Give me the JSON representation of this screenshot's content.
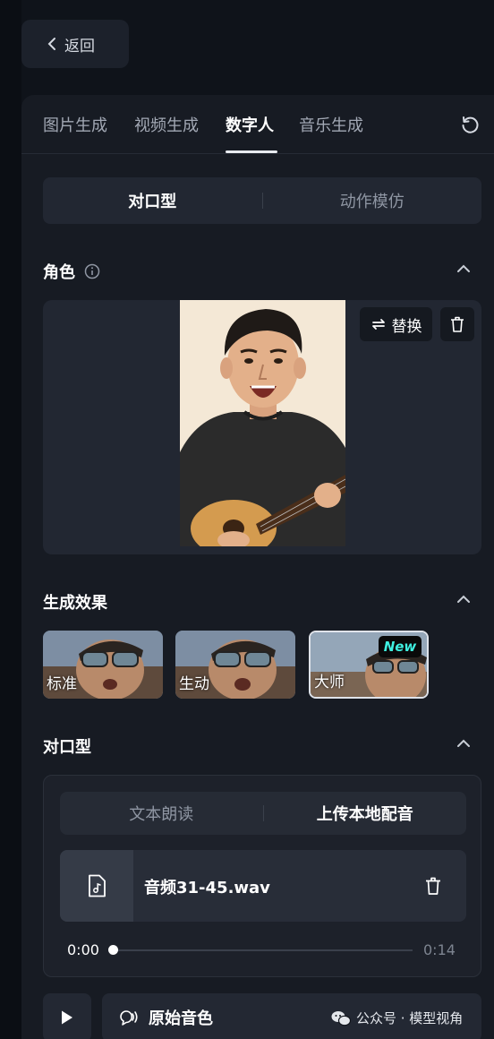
{
  "header": {
    "back_label": "返回"
  },
  "tabs": [
    {
      "label": "图片生成"
    },
    {
      "label": "视频生成"
    },
    {
      "label": "数字人"
    },
    {
      "label": "音乐生成"
    }
  ],
  "mode_switch": {
    "options": [
      "对口型",
      "动作模仿"
    ],
    "selected": "对口型"
  },
  "role": {
    "title": "角色",
    "replace_label": "替换"
  },
  "effects": {
    "title": "生成效果",
    "items": [
      {
        "label": "标准"
      },
      {
        "label": "生动"
      },
      {
        "label": "大师",
        "badge": "New"
      }
    ],
    "selected": "大师"
  },
  "lipsync": {
    "title": "对口型",
    "options": [
      "文本朗读",
      "上传本地配音"
    ],
    "selected": "上传本地配音",
    "file_name": "音频31-45.wav",
    "time_current": "0:00",
    "time_total": "0:14",
    "progress": 0
  },
  "voice": {
    "label": "原始音色"
  },
  "watermark": {
    "text": "公众号 · 模型视角"
  },
  "colors": {
    "background": "#0f131a",
    "panel": "#171b23",
    "badge_text": "#3ff0e0"
  }
}
